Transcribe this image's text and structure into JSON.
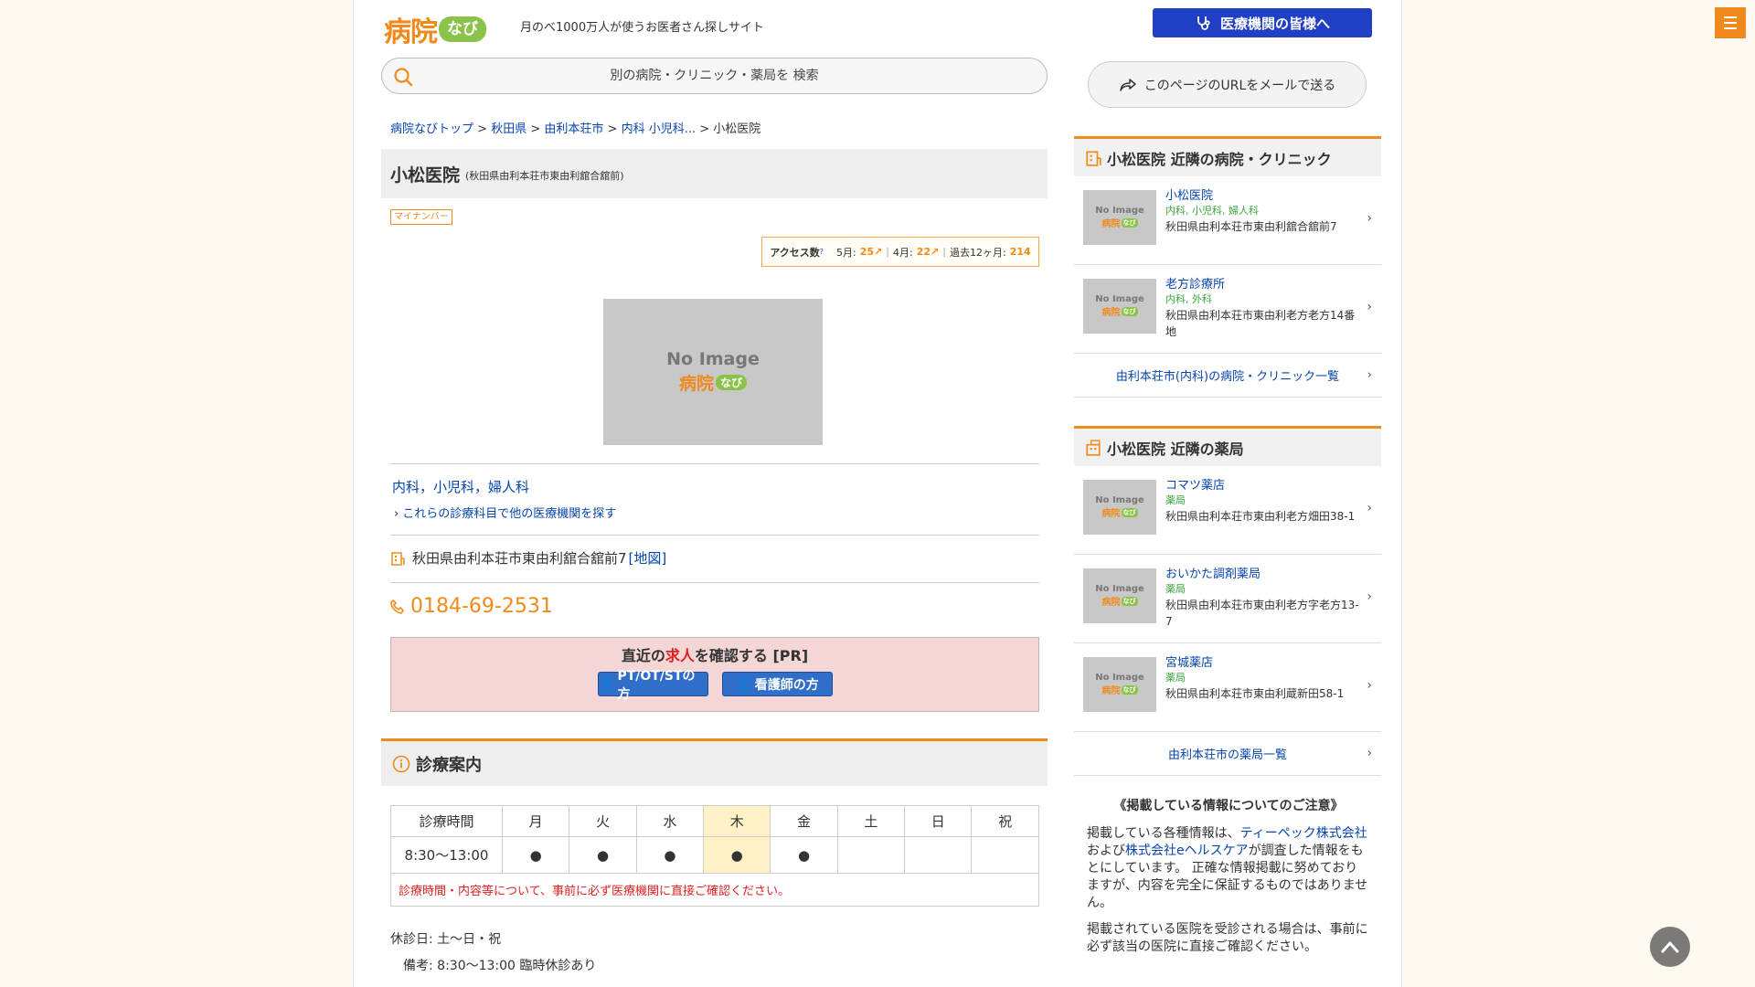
{
  "header": {
    "logo_text": "病院",
    "logo_badge": "なび",
    "tagline": "月のべ1000万人が使うお医者さん探しサイト",
    "med_button": "医療機関の皆様へ"
  },
  "search": {
    "placeholder": "別の病院・クリニック・薬局を 検索"
  },
  "share": {
    "label": "このページのURLをメールで送る"
  },
  "breadcrumb": {
    "items": [
      "病院なびトップ",
      "秋田県",
      "由利本荘市",
      "内科 小児科..."
    ],
    "current": "小松医院",
    "sep": " > "
  },
  "hospital": {
    "name": "小松医院",
    "sub": "(秋田県由利本荘市東由利舘合舘前)",
    "mynumber": "マイナンバー",
    "access": {
      "label": "アクセス数",
      "may_label": "5月:",
      "may": "25",
      "apr_label": "4月:",
      "apr": "22",
      "year_label": "過去12ヶ月:",
      "year": "214"
    },
    "noimage": {
      "text": "No Image",
      "brand": "病院",
      "badge": "なび"
    },
    "depts": "内科，小児科，婦人科",
    "depts_link": "これらの診療科目で他の医療機関を探す",
    "address": "秋田県由利本荘市東由利舘合舘前7",
    "map_link": "[地図]",
    "phone": "0184-69-2531"
  },
  "pr": {
    "title_pre": "直近の",
    "title_red": "求人",
    "title_post": "を確認する [PR]",
    "btn1": "PT/OT/STの方",
    "btn2": "看護師の方"
  },
  "schedule": {
    "section_title": "診療案内",
    "headers": [
      "診療時間",
      "月",
      "火",
      "水",
      "木",
      "金",
      "土",
      "日",
      "祝"
    ],
    "row": [
      "8:30～13:00",
      "●",
      "●",
      "●",
      "●",
      "●",
      "",
      "",
      ""
    ],
    "note": "診療時間・内容等について、事前に必ず医療機関に直接ご確認ください。",
    "holiday": "休診日: 土～日・祝",
    "remark": "備考: 8:30～13:00 臨時休診あり"
  },
  "nearby_clinics": {
    "title": "小松医院 近隣の病院・クリニック",
    "items": [
      {
        "name": "小松医院",
        "depts": "内科, 小児科, 婦人科",
        "address": "秋田県由利本荘市東由利舘合舘前7"
      },
      {
        "name": "老方診療所",
        "depts": "内科, 外科",
        "address": "秋田県由利本荘市東由利老方老方14番地"
      }
    ],
    "more": "由利本荘市(内科)の病院・クリニック一覧"
  },
  "nearby_pharmacies": {
    "title": "小松医院 近隣の薬局",
    "items": [
      {
        "name": "コマツ薬店",
        "depts": "薬局",
        "address": "秋田県由利本荘市東由利老方畑田38-1"
      },
      {
        "name": "おいかた調剤薬局",
        "depts": "薬局",
        "address": "秋田県由利本荘市東由利老方字老方13-7"
      },
      {
        "name": "宮城薬店",
        "depts": "薬局",
        "address": "秋田県由利本荘市東由利蔵新田58-1"
      }
    ],
    "more": "由利本荘市の薬局一覧"
  },
  "notice": {
    "title": "《掲載している情報についてのご注意》",
    "p1_a": "掲載している各種情報は、",
    "p1_link1": "ティーペック株式会社",
    "p1_b": "および",
    "p1_link2": "株式会社eヘルスケア",
    "p1_c": "が調査した情報をもとにしています。 正確な情報掲載に努めておりますが、内容を完全に保証するものではありません。",
    "p2": "掲載されている医院を受診される場合は、事前に必ず該当の医院に直接ご確認ください。"
  },
  "colors": {
    "accent": "#f08a1c",
    "brand_blue": "#1f3fc4",
    "link": "#0645ad",
    "badge_green": "#8bc34a"
  }
}
